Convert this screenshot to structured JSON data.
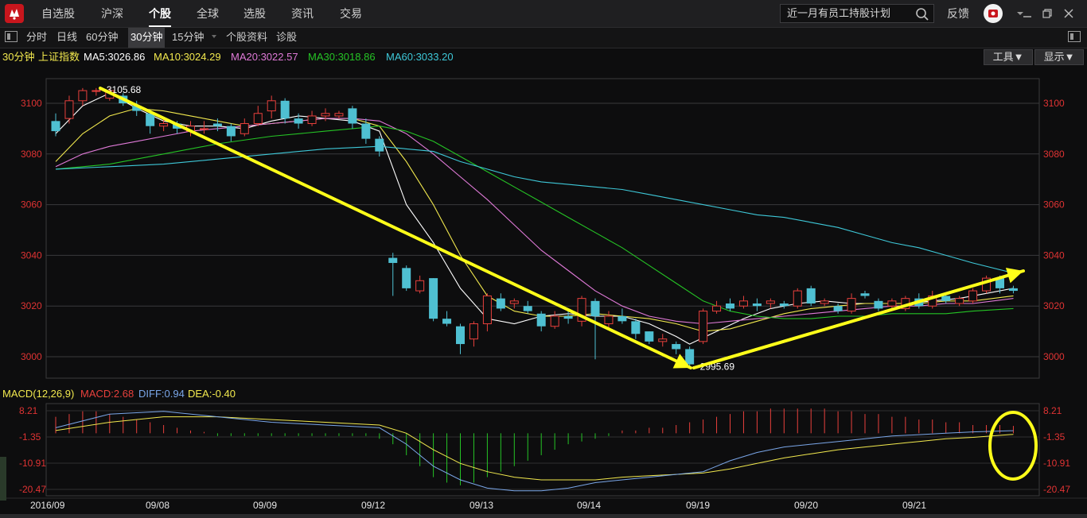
{
  "nav": {
    "items": [
      "自选股",
      "沪深",
      "个股",
      "全球",
      "选股",
      "资讯",
      "交易"
    ],
    "active_index": 2
  },
  "search": {
    "value": "近一月有员工持股计划"
  },
  "header_right": {
    "feedback": "反馈"
  },
  "toolbar": {
    "periods": [
      "分时",
      "日线",
      "60分钟",
      "30分钟",
      "15分钟"
    ],
    "active_period_index": 3,
    "links": [
      "个股资料",
      "诊股"
    ]
  },
  "ma_bar": {
    "period_label": "30分钟",
    "index_name": "上证指数",
    "ma5": "MA5:3026.86",
    "ma10": "MA10:3024.29",
    "ma20": "MA20:3022.57",
    "ma30": "MA30:3018.86",
    "ma60": "MA60:3033.20",
    "tools_button": "工具▼",
    "display_button": "显示▼"
  },
  "macd_bar": {
    "name": "MACD(12,26,9)",
    "macd": "MACD:2.68",
    "diff": "DIFF:0.94",
    "dea": "DEA:-0.40"
  },
  "colors": {
    "bg": "#0d0d0e",
    "up": "#e8403c",
    "down": "#4fc0d2",
    "ma5": "#ffffff",
    "ma10": "#f2e94e",
    "ma20": "#e07ad8",
    "ma30": "#25c425",
    "ma60": "#3ec8d8",
    "diff": "#7aa6e8",
    "dea": "#f2e94e",
    "arrow": "#ffff1a",
    "axis_label": "#e03333"
  },
  "chart_data": {
    "type": "candlestick",
    "title": "上证指数 30分钟",
    "y_ticks": [
      3100,
      3080,
      3060,
      3040,
      3020,
      3000
    ],
    "ylim": [
      2991,
      3109
    ],
    "x_labels": [
      "2016/09",
      "09/08",
      "09/09",
      "09/12",
      "09/13",
      "09/14",
      "09/19",
      "09/20",
      "09/21"
    ],
    "annotations": {
      "high": "3105.68",
      "low": "2995.69"
    },
    "candles": [
      [
        3093,
        3089,
        3096,
        3087
      ],
      [
        3094,
        3101,
        3103,
        3092
      ],
      [
        3101,
        3105,
        3106,
        3099
      ],
      [
        3105,
        3105,
        3106,
        3103
      ],
      [
        3102,
        3105,
        3106,
        3101
      ],
      [
        3103,
        3100,
        3104,
        3099
      ],
      [
        3099,
        3097,
        3101,
        3095
      ],
      [
        3096,
        3091,
        3097,
        3088
      ],
      [
        3091,
        3092,
        3094,
        3089
      ],
      [
        3092,
        3090,
        3093,
        3088
      ],
      [
        3089,
        3091,
        3093,
        3087
      ],
      [
        3090,
        3090,
        3093,
        3088
      ],
      [
        3092,
        3091,
        3094,
        3089
      ],
      [
        3091,
        3087,
        3092,
        3085
      ],
      [
        3088,
        3092,
        3094,
        3087
      ],
      [
        3092,
        3096,
        3099,
        3091
      ],
      [
        3097,
        3101,
        3103,
        3094
      ],
      [
        3101,
        3094,
        3102,
        3092
      ],
      [
        3094,
        3092,
        3096,
        3090
      ],
      [
        3092,
        3095,
        3097,
        3091
      ],
      [
        3095,
        3096,
        3098,
        3093
      ],
      [
        3095,
        3096,
        3097,
        3094
      ],
      [
        3098,
        3092,
        3099,
        3090
      ],
      [
        3092,
        3086,
        3094,
        3084
      ],
      [
        3086,
        3081,
        3087,
        3079
      ],
      [
        3039,
        3037,
        3041,
        3024
      ],
      [
        3035,
        3027,
        3036,
        3026
      ],
      [
        3026,
        3030,
        3032,
        3025
      ],
      [
        3031,
        3015,
        3031,
        3014
      ],
      [
        3015,
        3013,
        3018,
        3012
      ],
      [
        3012,
        3005,
        3013,
        3001
      ],
      [
        3007,
        3013,
        3014,
        3004
      ],
      [
        3013,
        3024,
        3025,
        3010
      ],
      [
        3023,
        3019,
        3025,
        3018
      ],
      [
        3021,
        3022,
        3023,
        3019
      ],
      [
        3020,
        3018,
        3022,
        3017
      ],
      [
        3017,
        3012,
        3018,
        3010
      ],
      [
        3012,
        3016,
        3018,
        3011
      ],
      [
        3016,
        3015,
        3018,
        3013
      ],
      [
        3014,
        3023,
        3024,
        3012
      ],
      [
        3022,
        3016,
        3023,
        2999
      ],
      [
        3013,
        3016,
        3018,
        3011
      ],
      [
        3016,
        3014,
        3019,
        3013
      ],
      [
        3014,
        3009,
        3015,
        3007
      ],
      [
        3010,
        3006,
        3010,
        3005
      ],
      [
        3006,
        3007,
        3009,
        3004
      ],
      [
        3005,
        3003,
        3006,
        3001
      ],
      [
        3003,
        2997,
        3004,
        2996
      ],
      [
        3006,
        3018,
        3019,
        3005
      ],
      [
        3018,
        3020,
        3022,
        3017
      ],
      [
        3021,
        3019,
        3023,
        3018
      ],
      [
        3020,
        3022,
        3024,
        3019
      ],
      [
        3021,
        3020,
        3023,
        3018
      ],
      [
        3021,
        3022,
        3023,
        3019
      ],
      [
        3021,
        3020,
        3022,
        3019
      ],
      [
        3020,
        3026,
        3027,
        3019
      ],
      [
        3027,
        3021,
        3028,
        3020
      ],
      [
        3021,
        3022,
        3023,
        3020
      ],
      [
        3020,
        3018,
        3021,
        3017
      ],
      [
        3018,
        3023,
        3025,
        3017
      ],
      [
        3025,
        3024,
        3026,
        3023
      ],
      [
        3022,
        3019,
        3023,
        3018
      ],
      [
        3020,
        3022,
        3023,
        3019
      ],
      [
        3019,
        3023,
        3024,
        3018
      ],
      [
        3023,
        3020,
        3025,
        3019
      ],
      [
        3020,
        3024,
        3026,
        3019
      ],
      [
        3024,
        3022,
        3025,
        3021
      ],
      [
        3021,
        3023,
        3024,
        3020
      ],
      [
        3022,
        3026,
        3027,
        3021
      ],
      [
        3026,
        3031,
        3032,
        3025
      ],
      [
        3031,
        3027,
        3032,
        3025
      ],
      [
        3027,
        3026,
        3028,
        3025
      ]
    ],
    "ma": {
      "MA5": [
        [
          0,
          3088
        ],
        [
          2,
          3099
        ],
        [
          4,
          3104
        ],
        [
          6,
          3098
        ],
        [
          8,
          3093
        ],
        [
          10,
          3091
        ],
        [
          12,
          3091
        ],
        [
          14,
          3090
        ],
        [
          16,
          3093
        ],
        [
          18,
          3095
        ],
        [
          20,
          3094
        ],
        [
          22,
          3093
        ],
        [
          24,
          3089
        ],
        [
          26,
          3060
        ],
        [
          28,
          3045
        ],
        [
          30,
          3027
        ],
        [
          32,
          3015
        ],
        [
          34,
          3013
        ],
        [
          36,
          3016
        ],
        [
          38,
          3017
        ],
        [
          40,
          3016
        ],
        [
          42,
          3016
        ],
        [
          44,
          3013
        ],
        [
          46,
          3008
        ],
        [
          47,
          3005
        ],
        [
          49,
          3010
        ],
        [
          51,
          3015
        ],
        [
          53,
          3019
        ],
        [
          55,
          3021
        ],
        [
          57,
          3022
        ],
        [
          59,
          3021
        ],
        [
          61,
          3021
        ],
        [
          63,
          3021
        ],
        [
          65,
          3022
        ],
        [
          67,
          3023
        ],
        [
          69,
          3025
        ],
        [
          71,
          3027
        ]
      ],
      "MA10": [
        [
          0,
          3077
        ],
        [
          2,
          3088
        ],
        [
          4,
          3095
        ],
        [
          6,
          3098
        ],
        [
          8,
          3097
        ],
        [
          10,
          3095
        ],
        [
          12,
          3093
        ],
        [
          14,
          3091
        ],
        [
          16,
          3092
        ],
        [
          18,
          3093
        ],
        [
          20,
          3094
        ],
        [
          22,
          3094
        ],
        [
          24,
          3091
        ],
        [
          26,
          3077
        ],
        [
          28,
          3060
        ],
        [
          30,
          3040
        ],
        [
          32,
          3024
        ],
        [
          34,
          3018
        ],
        [
          36,
          3016
        ],
        [
          38,
          3016
        ],
        [
          40,
          3017
        ],
        [
          42,
          3016
        ],
        [
          44,
          3015
        ],
        [
          46,
          3013
        ],
        [
          48,
          3010
        ],
        [
          50,
          3011
        ],
        [
          52,
          3014
        ],
        [
          54,
          3017
        ],
        [
          56,
          3019
        ],
        [
          58,
          3020
        ],
        [
          60,
          3021
        ],
        [
          62,
          3021
        ],
        [
          64,
          3021
        ],
        [
          66,
          3022
        ],
        [
          68,
          3022
        ],
        [
          71,
          3024
        ]
      ],
      "MA20": [
        [
          0,
          3075
        ],
        [
          2,
          3080
        ],
        [
          4,
          3083
        ],
        [
          6,
          3085
        ],
        [
          8,
          3087
        ],
        [
          10,
          3089
        ],
        [
          12,
          3090
        ],
        [
          14,
          3091
        ],
        [
          16,
          3092
        ],
        [
          18,
          3093
        ],
        [
          20,
          3094
        ],
        [
          22,
          3094
        ],
        [
          24,
          3093
        ],
        [
          26,
          3088
        ],
        [
          28,
          3080
        ],
        [
          30,
          3071
        ],
        [
          32,
          3062
        ],
        [
          34,
          3052
        ],
        [
          36,
          3042
        ],
        [
          38,
          3034
        ],
        [
          40,
          3026
        ],
        [
          42,
          3020
        ],
        [
          44,
          3016
        ],
        [
          46,
          3014
        ],
        [
          48,
          3013
        ],
        [
          50,
          3014
        ],
        [
          52,
          3015
        ],
        [
          54,
          3016
        ],
        [
          56,
          3017
        ],
        [
          58,
          3018
        ],
        [
          60,
          3019
        ],
        [
          62,
          3020
        ],
        [
          64,
          3020
        ],
        [
          66,
          3021
        ],
        [
          68,
          3021
        ],
        [
          71,
          3023
        ]
      ],
      "MA30": [
        [
          0,
          3074
        ],
        [
          4,
          3076
        ],
        [
          8,
          3080
        ],
        [
          12,
          3084
        ],
        [
          16,
          3087
        ],
        [
          20,
          3089
        ],
        [
          22,
          3090
        ],
        [
          24,
          3091
        ],
        [
          26,
          3089
        ],
        [
          28,
          3085
        ],
        [
          30,
          3079
        ],
        [
          32,
          3073
        ],
        [
          34,
          3067
        ],
        [
          36,
          3061
        ],
        [
          38,
          3055
        ],
        [
          40,
          3049
        ],
        [
          42,
          3043
        ],
        [
          44,
          3036
        ],
        [
          46,
          3029
        ],
        [
          48,
          3022
        ],
        [
          50,
          3018
        ],
        [
          52,
          3016
        ],
        [
          54,
          3015
        ],
        [
          56,
          3015
        ],
        [
          58,
          3016
        ],
        [
          60,
          3016
        ],
        [
          62,
          3017
        ],
        [
          64,
          3017
        ],
        [
          66,
          3017
        ],
        [
          68,
          3018
        ],
        [
          71,
          3019
        ]
      ],
      "MA60": [
        [
          0,
          3074
        ],
        [
          4,
          3075
        ],
        [
          8,
          3076
        ],
        [
          12,
          3078
        ],
        [
          16,
          3080
        ],
        [
          20,
          3082
        ],
        [
          24,
          3083
        ],
        [
          28,
          3081
        ],
        [
          30,
          3077
        ],
        [
          32,
          3074
        ],
        [
          34,
          3071
        ],
        [
          36,
          3069
        ],
        [
          38,
          3068
        ],
        [
          40,
          3067
        ],
        [
          42,
          3066
        ],
        [
          44,
          3064
        ],
        [
          46,
          3062
        ],
        [
          48,
          3060
        ],
        [
          50,
          3058
        ],
        [
          52,
          3056
        ],
        [
          54,
          3055
        ],
        [
          56,
          3053
        ],
        [
          58,
          3051
        ],
        [
          60,
          3048
        ],
        [
          62,
          3045
        ],
        [
          64,
          3043
        ],
        [
          66,
          3040
        ],
        [
          68,
          3037
        ],
        [
          71,
          3033
        ]
      ]
    },
    "macd": {
      "ylim": [
        -20.47,
        8.21
      ],
      "y_ticks": [
        8.21,
        -1.35,
        -10.91,
        -20.47
      ],
      "hist": [
        6,
        7,
        8,
        8,
        7,
        6,
        5,
        4,
        3,
        2,
        1,
        0.5,
        -1,
        -1,
        -1,
        -1,
        -1,
        -1,
        -1,
        -1,
        -1,
        -1,
        -1,
        -1,
        -2,
        -4,
        -8,
        -12,
        -16,
        -18,
        -19,
        -18,
        -16,
        -14,
        -12,
        -10,
        -8,
        -6,
        -4,
        -3,
        -2,
        -1,
        1,
        1,
        2,
        2,
        3,
        4,
        5,
        6,
        7,
        8,
        8,
        9,
        9,
        9,
        9,
        9,
        8,
        8,
        7,
        7,
        6,
        6,
        5,
        5,
        4,
        4,
        3,
        3,
        3,
        2.68
      ],
      "diff": [
        [
          0,
          2
        ],
        [
          4,
          7
        ],
        [
          8,
          8
        ],
        [
          12,
          6
        ],
        [
          16,
          4
        ],
        [
          20,
          3
        ],
        [
          24,
          2
        ],
        [
          26,
          -4
        ],
        [
          28,
          -12
        ],
        [
          30,
          -17
        ],
        [
          32,
          -20
        ],
        [
          34,
          -21
        ],
        [
          36,
          -21
        ],
        [
          38,
          -20
        ],
        [
          40,
          -18
        ],
        [
          42,
          -17
        ],
        [
          44,
          -16
        ],
        [
          46,
          -15
        ],
        [
          48,
          -14
        ],
        [
          50,
          -10
        ],
        [
          52,
          -7
        ],
        [
          54,
          -5
        ],
        [
          56,
          -4
        ],
        [
          58,
          -3
        ],
        [
          60,
          -2
        ],
        [
          62,
          -1
        ],
        [
          64,
          -0.5
        ],
        [
          66,
          0
        ],
        [
          68,
          0.5
        ],
        [
          71,
          0.94
        ]
      ],
      "dea": [
        [
          0,
          1
        ],
        [
          4,
          4
        ],
        [
          8,
          6
        ],
        [
          12,
          6
        ],
        [
          16,
          5
        ],
        [
          20,
          4
        ],
        [
          24,
          3
        ],
        [
          26,
          0
        ],
        [
          28,
          -6
        ],
        [
          30,
          -11
        ],
        [
          32,
          -14
        ],
        [
          34,
          -16
        ],
        [
          36,
          -17
        ],
        [
          38,
          -17
        ],
        [
          40,
          -17
        ],
        [
          42,
          -16
        ],
        [
          44,
          -15.5
        ],
        [
          46,
          -15
        ],
        [
          48,
          -14.5
        ],
        [
          50,
          -13
        ],
        [
          52,
          -11
        ],
        [
          54,
          -9
        ],
        [
          56,
          -7.5
        ],
        [
          58,
          -6
        ],
        [
          60,
          -5
        ],
        [
          62,
          -4
        ],
        [
          64,
          -3
        ],
        [
          66,
          -2
        ],
        [
          68,
          -1.5
        ],
        [
          71,
          -0.4
        ]
      ]
    }
  }
}
